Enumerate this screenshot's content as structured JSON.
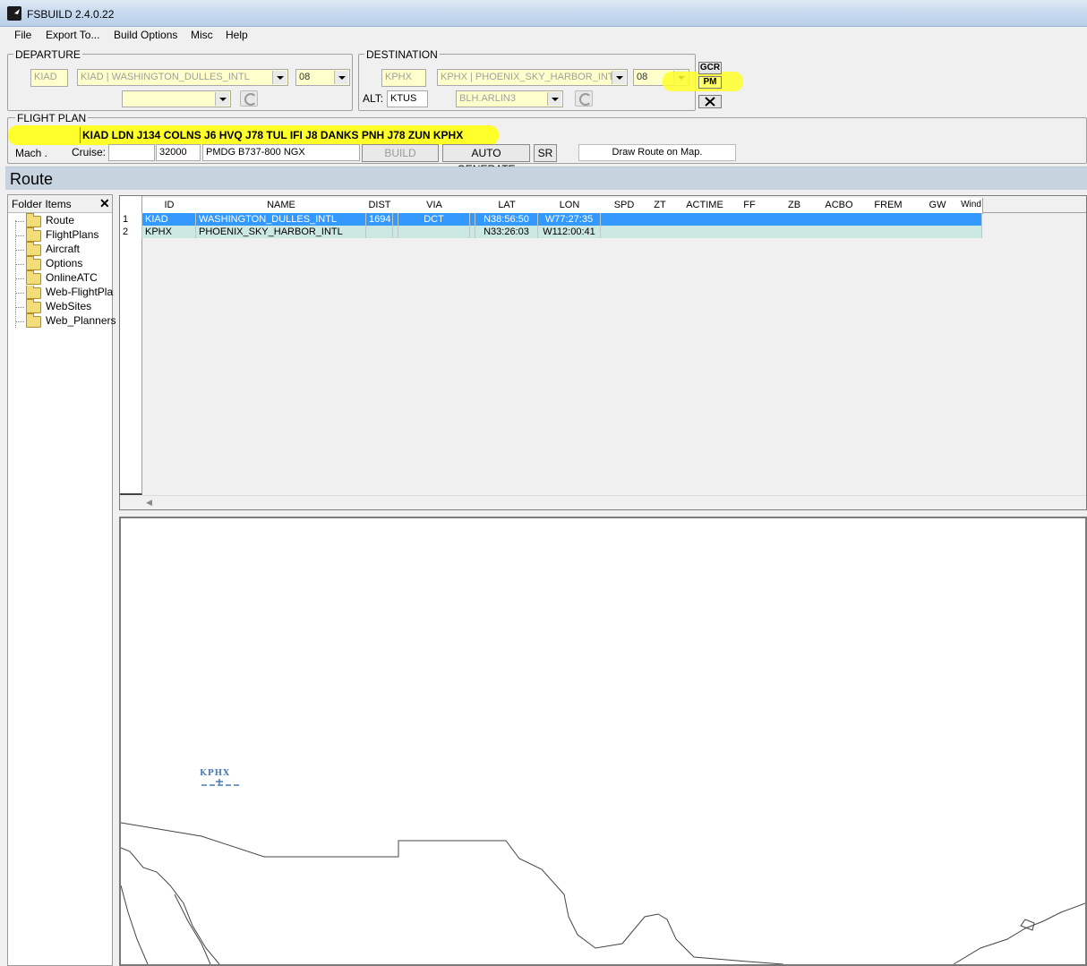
{
  "window": {
    "title": "FSBUILD 2.4.0.22"
  },
  "menu": [
    "File",
    "Export To...",
    "Build Options",
    "Misc",
    "Help"
  ],
  "departure": {
    "label": "DEPARTURE",
    "icao": "KIAD",
    "airport": "KIAD | WASHINGTON_DULLES_INTL",
    "runway": "08",
    "procedure": ""
  },
  "destination": {
    "label": "DESTINATION",
    "icao": "KPHX",
    "airport": "KPHX | PHOENIX_SKY_HARBOR_INTL",
    "runway": "08",
    "alt_label": "ALT:",
    "alternate": "KTUS",
    "procedure": "BLH.ARLIN3"
  },
  "side_buttons": {
    "gcr": "GCR",
    "pm": "PM"
  },
  "flight_plan": {
    "label": "FLIGHT PLAN",
    "route": "KIAD LDN J134 COLNS J6 HVQ J78 TUL IFI J8 DANKS PNH J78 ZUN KPHX",
    "mach_label": "Mach .",
    "mach": "",
    "cruise_label": "Cruise:",
    "cruise": "32000",
    "aircraft": "PMDG B737-800 NGX",
    "build_label": "BUILD",
    "auto_generate_label": "AUTO GENERATE",
    "sr_label": "SR",
    "draw_route_label": "Draw Route on Map."
  },
  "route_section": {
    "title": "Route"
  },
  "folder_panel": {
    "header": "Folder Items",
    "items": [
      "Route",
      "FlightPlans",
      "Aircraft",
      "Options",
      "OnlineATC",
      "Web-FlightPlans",
      "WebSites",
      "Web_Planners"
    ]
  },
  "grid": {
    "columns": [
      "ID",
      "NAME",
      "DIST",
      "VIA",
      "LAT",
      "LON",
      "SPD",
      "ZT",
      "ACTIME",
      "FF",
      "ZB",
      "ACBO",
      "FREM",
      "GW",
      "Wind"
    ],
    "rows": [
      {
        "num": "1",
        "id": "KIAD",
        "name": "WASHINGTON_DULLES_INTL",
        "dist": "1694",
        "via": "DCT",
        "lat": "N38:56:50",
        "lon": "W77:27:35"
      },
      {
        "num": "2",
        "id": "KPHX",
        "name": "PHOENIX_SKY_HARBOR_INTL",
        "dist": "",
        "via": "",
        "lat": "N33:26:03",
        "lon": "W112:00:41"
      }
    ]
  },
  "map": {
    "marker_label": "KPHX"
  },
  "colors": {
    "highlight": "#ffff2a",
    "selection": "#3399ff",
    "alt_row": "#cce8e3",
    "field_bg": "#ffffcc"
  }
}
